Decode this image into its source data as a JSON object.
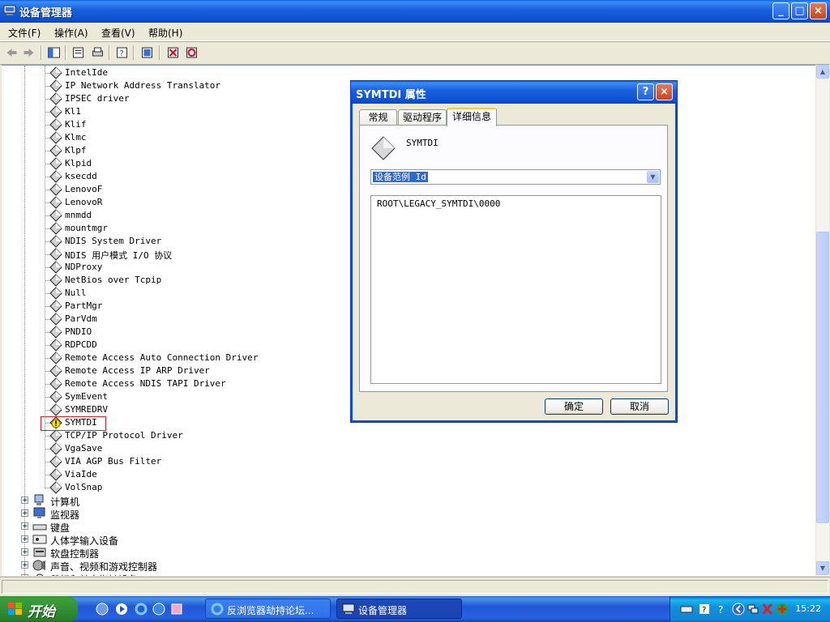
{
  "window": {
    "title": "设备管理器",
    "controls": {
      "minimize": "_",
      "maximize": "□",
      "close": "×"
    }
  },
  "menu": [
    "文件(F)",
    "操作(A)",
    "查看(V)",
    "帮助(H)"
  ],
  "toolbar_icons": [
    "back-icon",
    "forward-icon",
    "console-tree-icon",
    "properties-icon",
    "print-icon",
    "help-icon",
    "scan-hardware-icon",
    "uninstall-icon",
    "disable-icon"
  ],
  "tree": {
    "devices": [
      "IntelIde",
      "IP Network Address Translator",
      "IPSEC driver",
      "Kl1",
      "Klif",
      "Klmc",
      "Klpf",
      "Klpid",
      "ksecdd",
      "LenovoF",
      "LenovoR",
      "mnmdd",
      "mountmgr",
      "NDIS System Driver",
      "NDIS 用户模式 I/O 协议",
      "NDProxy",
      "NetBios over Tcpip",
      "Null",
      "PartMgr",
      "ParVdm",
      "PNDIO",
      "RDPCDD",
      "Remote Access Auto Connection Driver",
      "Remote Access IP ARP Driver",
      "Remote Access NDIS TAPI Driver",
      "SymEvent",
      "SYMREDRV",
      "SYMTDI",
      "TCP/IP Protocol Driver",
      "VgaSave",
      "VIA AGP Bus Filter",
      "ViaIde",
      "VolSnap"
    ],
    "highlighted_device": "SYMTDI",
    "categories": [
      "计算机",
      "监视器",
      "键盘",
      "人体学输入设备",
      "软盘控制器",
      "声音、视频和游戏控制器",
      "鼠标和其它指针设备"
    ]
  },
  "dialog": {
    "title": "SYMTDI 属性",
    "help_btn": "?",
    "close_btn": "×",
    "tabs": [
      "常规",
      "驱动程序",
      "详细信息"
    ],
    "active_tab": "详细信息",
    "device_name": "SYMTDI",
    "property_selected": "设备范例 Id",
    "value_items": [
      "ROOT\\LEGACY_SYMTDI\\0000"
    ],
    "ok": "确定",
    "cancel": "取消"
  },
  "taskbar": {
    "start": "开始",
    "items": [
      "反浏览器劫持论坛...",
      "设备管理器"
    ],
    "clock": "15:22"
  },
  "colors": {
    "title_blue": "#0A4FD2",
    "taskbar_blue": "#245EDC",
    "start_green": "#3A9C3A",
    "selection": "#316AC5",
    "highlight_box": "#FF0000"
  }
}
